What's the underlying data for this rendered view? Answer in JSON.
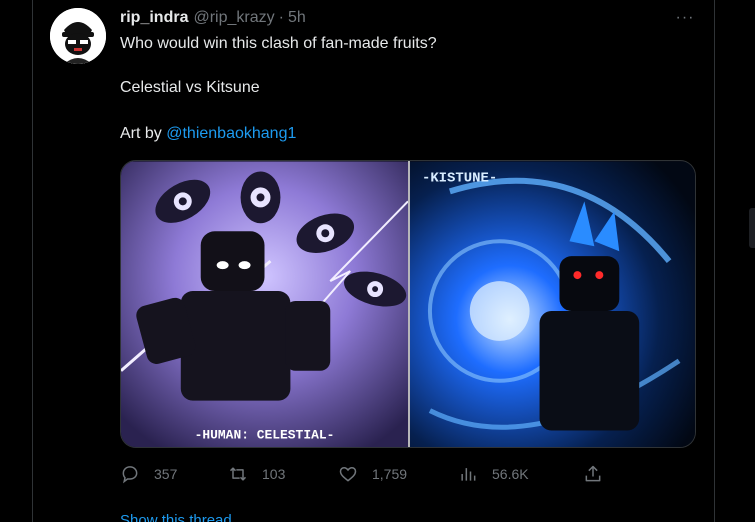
{
  "tweet": {
    "display_name": "rip_indra",
    "handle": "@rip_krazy",
    "separator": "·",
    "time": "5h",
    "more_label": "···",
    "text_line1": "Who would win this clash of fan-made fruits?",
    "text_line2": "Celestial vs Kitsune",
    "text_line3_prefix": "Art by ",
    "mention": "@thienbaokhang1"
  },
  "media": {
    "left_caption": "-HUMAN: CELESTIAL-",
    "right_caption": "-KISTUNE-",
    "left_tint": "#8e7ad6",
    "right_tint": "#1e6dff"
  },
  "actions": {
    "reply_count": "357",
    "retweet_count": "103",
    "like_count": "1,759",
    "views_count": "56.6K"
  },
  "colors": {
    "accent": "#1d9bf0",
    "muted": "#71767b",
    "text": "#e7e9ea",
    "border": "#2f3336"
  },
  "footer": {
    "show_thread_label": "Show this thread"
  }
}
